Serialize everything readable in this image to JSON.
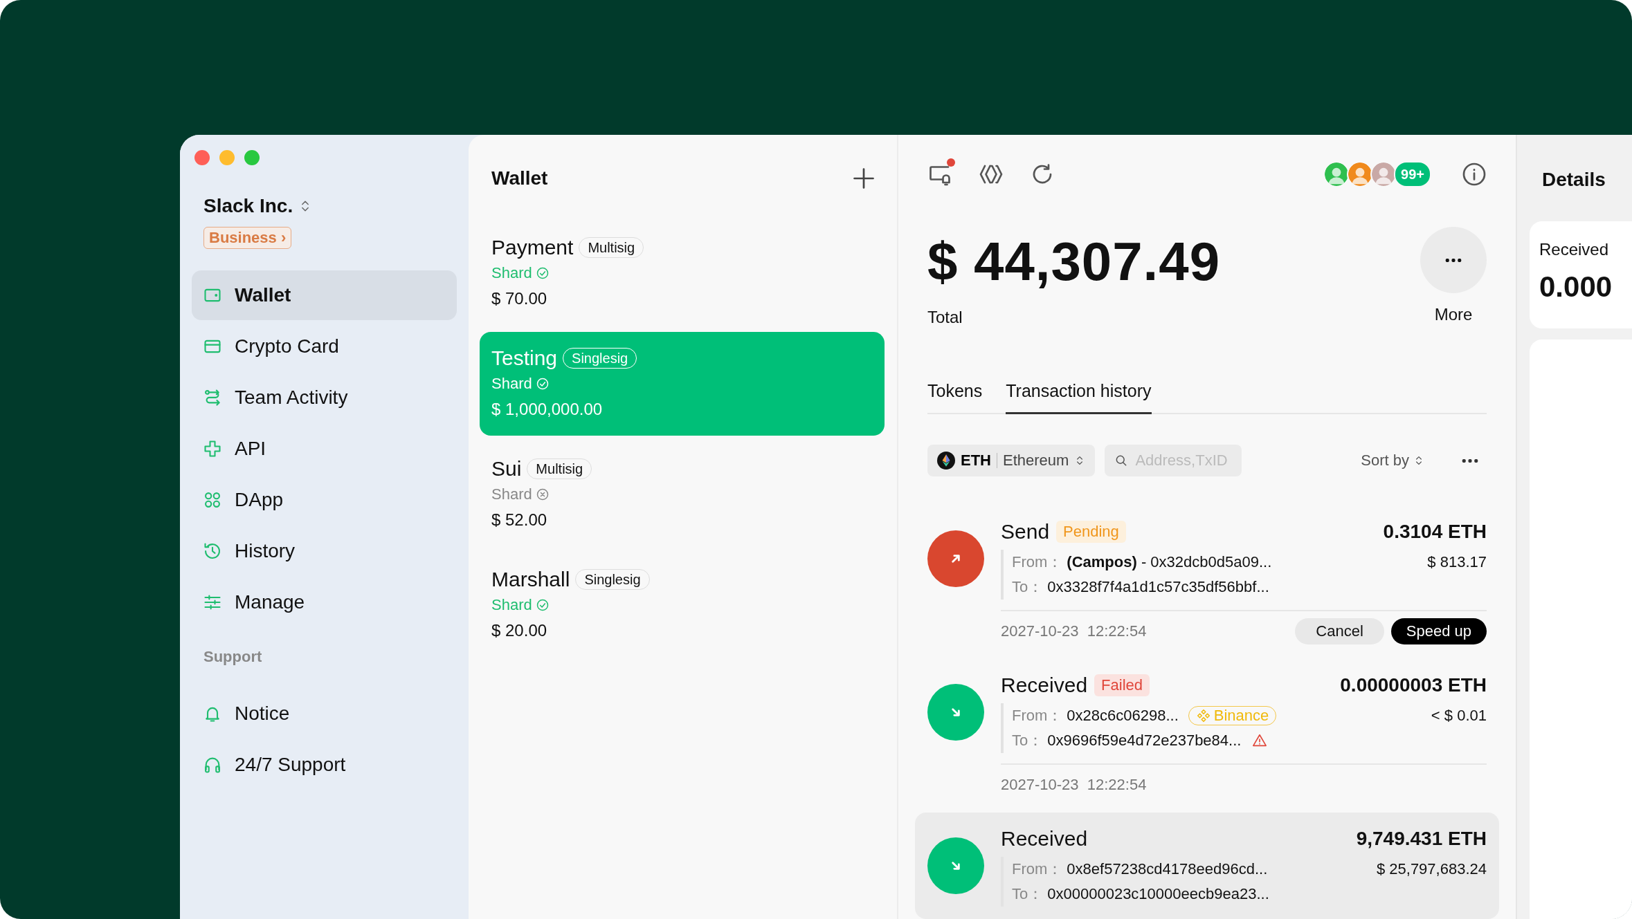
{
  "sidebar": {
    "org": "Slack Inc.",
    "plan": "Business ›",
    "items": [
      {
        "label": "Wallet",
        "selected": true
      },
      {
        "label": "Crypto Card",
        "selected": false
      },
      {
        "label": "Team Activity",
        "selected": false
      },
      {
        "label": "API",
        "selected": false
      },
      {
        "label": "DApp",
        "selected": false
      },
      {
        "label": "History",
        "selected": false
      },
      {
        "label": "Manage",
        "selected": false
      }
    ],
    "support_heading": "Support",
    "support_items": [
      {
        "label": "Notice",
        "selected": false
      },
      {
        "label": "24/7 Support",
        "selected": false
      }
    ]
  },
  "wallet_list": {
    "title": "Wallet",
    "wallets": [
      {
        "name": "Payment",
        "type": "Multisig",
        "shard": "Shard",
        "shard_ok": true,
        "amount": "$ 70.00",
        "selected": false
      },
      {
        "name": "Testing",
        "type": "Singlesig",
        "shard": "Shard",
        "shard_ok": true,
        "amount": "$ 1,000,000.00",
        "selected": true
      },
      {
        "name": "Sui",
        "type": "Multisig",
        "shard": "Shard",
        "shard_ok": false,
        "amount": "$ 52.00",
        "selected": false
      },
      {
        "name": "Marshall",
        "type": "Singlesig",
        "shard": "Shard",
        "shard_ok": true,
        "amount": "$ 20.00",
        "selected": false
      }
    ]
  },
  "toolbar": {
    "notification_dot": true,
    "avatars": [
      {
        "color": "#2fbf4f"
      },
      {
        "color": "#f08a1c"
      },
      {
        "color": "#c9a9a6"
      }
    ],
    "member_count": "99+"
  },
  "balance": {
    "amount": "$ 44,307.49",
    "label": "Total",
    "more_label": "More"
  },
  "tabs": [
    {
      "label": "Tokens",
      "selected": false
    },
    {
      "label": "Transaction history",
      "selected": true
    }
  ],
  "filters": {
    "chain_symbol": "ETH",
    "chain_name": "Ethereum",
    "search_placeholder": "Address,TxID",
    "sort_label": "Sort by"
  },
  "transactions": [
    {
      "kind": "send",
      "title": "Send",
      "status": {
        "label": "Pending",
        "kind": "pending"
      },
      "amount": "0.3104 ETH",
      "value": "$ 813.17",
      "from_label": "From：",
      "from": "**(Campos)** - 0x32dcb0d5a09...",
      "to_label": "To：",
      "to": "0x3328f7f4a1d1c57c35df56bbf...",
      "to_warning": false,
      "date": "2027-10-23  12:22:54",
      "actions": [
        {
          "label": "Cancel",
          "kind": "secondary"
        },
        {
          "label": "Speed up",
          "kind": "primary"
        }
      ],
      "highlighted": false
    },
    {
      "kind": "receive",
      "title": "Received",
      "status": {
        "label": "Failed",
        "kind": "failed"
      },
      "amount": "0.00000003 ETH",
      "value": "< $ 0.01",
      "from_label": "From：",
      "from": "0x28c6c06298...",
      "from_tag": "Binance",
      "to_label": "To：",
      "to": "0x9696f59e4d72e237be84...",
      "to_warning": true,
      "date": "2027-10-23  12:22:54",
      "highlighted": false
    },
    {
      "kind": "receive",
      "title": "Received",
      "amount": "9,749.431 ETH",
      "value": "$ 25,797,683.24",
      "from_label": "From：",
      "from": "0x8ef57238cd4178eed96cd...",
      "to_label": "To：",
      "to": "0x00000023c10000eecb9ea23...",
      "to_warning": false,
      "highlighted": true
    }
  ],
  "details": {
    "title": "Details",
    "card_label": "Received",
    "card_value": "0.000"
  }
}
